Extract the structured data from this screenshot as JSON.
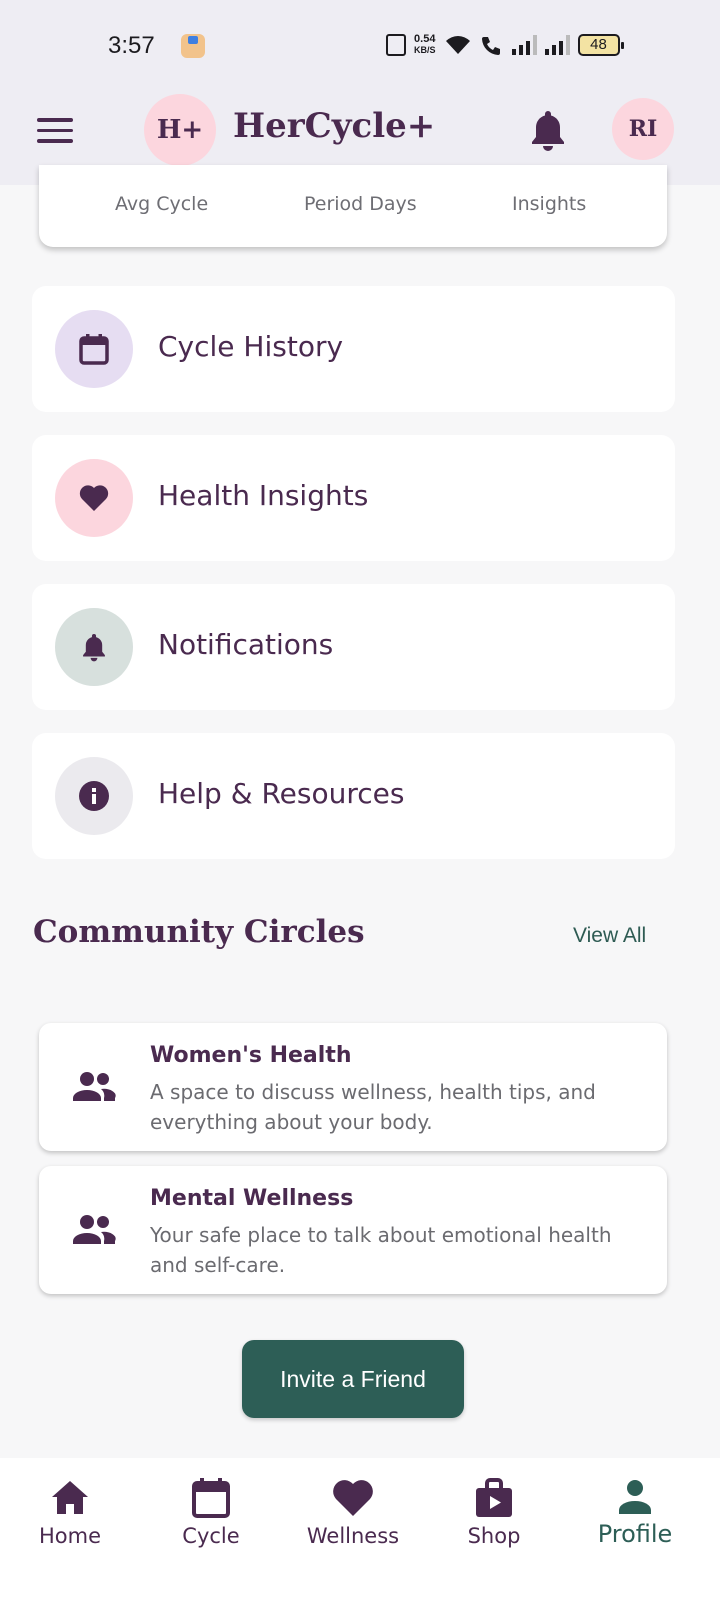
{
  "status_bar": {
    "time": "3:57",
    "net_speed": "0.54",
    "net_unit": "KB/S",
    "battery": "48"
  },
  "header": {
    "logo_text": "H+",
    "title": "HerCycle+",
    "avatar_initials": "RI"
  },
  "stats": {
    "labels": [
      "Avg Cycle",
      "Period Days",
      "Insights"
    ]
  },
  "menu": [
    {
      "label": "Cycle History",
      "icon": "calendar-icon",
      "circle_color": "#e6ddf2"
    },
    {
      "label": "Health Insights",
      "icon": "heart-icon",
      "circle_color": "#fcd6de"
    },
    {
      "label": "Notifications",
      "icon": "bell-icon",
      "circle_color": "#d7e0dd"
    },
    {
      "label": "Help & Resources",
      "icon": "info-icon",
      "circle_color": "#ebeaee"
    }
  ],
  "community": {
    "title": "Community Circles",
    "view_all": "View All",
    "circles": [
      {
        "name": "Women's Health",
        "description": "A space to discuss wellness, health tips, and everything about your body."
      },
      {
        "name": "Mental Wellness",
        "description": "Your safe place to talk about emotional health and self-care."
      }
    ]
  },
  "invite_label": "Invite a Friend",
  "nav": [
    {
      "label": "Home",
      "icon": "home-icon"
    },
    {
      "label": "Cycle",
      "icon": "calendar-icon"
    },
    {
      "label": "Wellness",
      "icon": "heart-icon"
    },
    {
      "label": "Shop",
      "icon": "shopping-bag-icon"
    },
    {
      "label": "Profile",
      "icon": "person-icon",
      "active": true
    }
  ],
  "colors": {
    "primary": "#4a2a4f",
    "accent": "#2d5e56",
    "pink": "#fcd6de",
    "header_bg": "#eeedf3"
  }
}
